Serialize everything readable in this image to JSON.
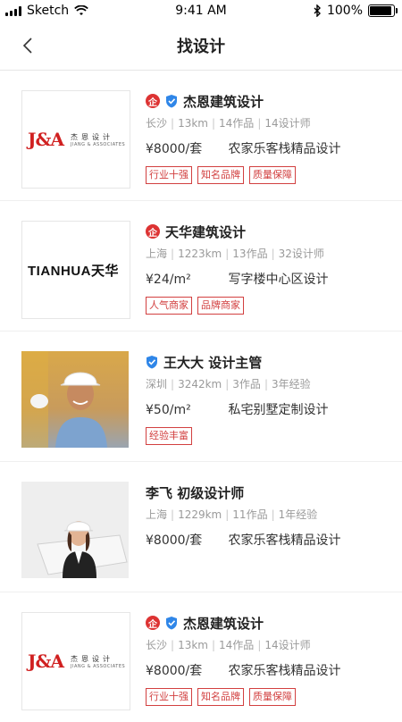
{
  "status_bar": {
    "carrier": "Sketch",
    "time": "9:41 AM",
    "battery": "100%",
    "battery_level": 1.0,
    "icons": [
      "signal-icon",
      "wifi-icon",
      "bluetooth-icon",
      "battery-icon"
    ]
  },
  "nav": {
    "back_icon": "chevron-left-icon",
    "title": "找设计"
  },
  "listings": [
    {
      "name": "杰恩建筑设计",
      "enterprise_badge": "企",
      "verified": true,
      "city": "长沙",
      "distance": "13km",
      "works": "14作品",
      "extra": "14设计师",
      "price": "¥8000/套",
      "project": "农家乐客栈精品设计",
      "tags": [
        "行业十强",
        "知名品牌",
        "质量保障"
      ],
      "logo": {
        "mark": "J&A",
        "cn": "杰恩设计",
        "en": "JIANG & ASSOCIATES"
      }
    },
    {
      "name": "天华建筑设计",
      "enterprise_badge": "企",
      "verified": false,
      "city": "上海",
      "distance": "1223km",
      "works": "13作品",
      "extra": "32设计师",
      "price": "¥24/m²",
      "project": "写字楼中心区设计",
      "tags": [
        "人气商家",
        "品牌商家"
      ],
      "logo": {
        "text": "TIANHUA天华"
      }
    },
    {
      "name": "王大大 设计主管",
      "verified": true,
      "city": "深圳",
      "distance": "3242km",
      "works": "3作品",
      "extra": "3年经验",
      "price": "¥50/m²",
      "project": "私宅别墅定制设计",
      "tags": [
        "经验丰富"
      ]
    },
    {
      "name": "李飞 初级设计师",
      "verified": false,
      "city": "上海",
      "distance": "1229km",
      "works": "11作品",
      "extra": "1年经验",
      "price": "¥8000/套",
      "project": "农家乐客栈精品设计",
      "tags": []
    },
    {
      "name": "杰恩建筑设计",
      "enterprise_badge": "企",
      "verified": true,
      "city": "长沙",
      "distance": "13km",
      "works": "14作品",
      "extra": "14设计师",
      "price": "¥8000/套",
      "project": "农家乐客栈精品设计",
      "tags": [
        "行业十强",
        "知名品牌",
        "质量保障"
      ],
      "logo": {
        "mark": "J&A",
        "cn": "杰恩设计",
        "en": "JIANG & ASSOCIATES"
      }
    }
  ],
  "colors": {
    "accent_red": "#d24040",
    "verified_blue": "#2f86e8",
    "muted_text": "#9a9a9a"
  }
}
